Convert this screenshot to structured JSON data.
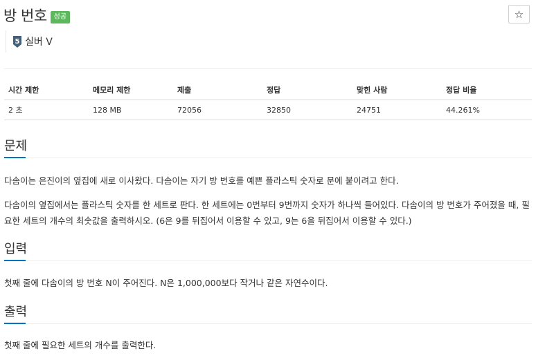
{
  "problem": {
    "title": "방 번호",
    "status": "성공",
    "star": "☆",
    "tier_number": "5",
    "tier_label": "실버 V"
  },
  "info_table": {
    "headers": [
      "시간 제한",
      "메모리 제한",
      "제출",
      "정답",
      "맞힌 사람",
      "정답 비율"
    ],
    "row": [
      "2 초",
      "128 MB",
      "72056",
      "32850",
      "24751",
      "44.261%"
    ]
  },
  "sections": {
    "description": {
      "title": "문제",
      "paragraphs": [
        "다솜이는 은진이의 옆집에 새로 이사왔다. 다솜이는 자기 방 번호를 예쁜 플라스틱 숫자로 문에 붙이려고 한다.",
        "다솜이의 옆집에서는 플라스틱 숫자를 한 세트로 판다. 한 세트에는 0번부터 9번까지 숫자가 하나씩 들어있다. 다솜이의 방 번호가 주어졌을 때, 필요한 세트의 개수의 최솟값을 출력하시오. (6은 9를 뒤집어서 이용할 수 있고, 9는 6을 뒤집어서 이용할 수 있다.)"
      ]
    },
    "input": {
      "title": "입력",
      "text": "첫째 줄에 다솜이의 방 번호 N이 주어진다. N은 1,000,000보다 작거나 같은 자연수이다."
    },
    "output": {
      "title": "출력",
      "text": "첫째 줄에 필요한 세트의 개수를 출력한다."
    }
  },
  "colors": {
    "status_green": "#5cb85c",
    "section_accent": "#0076c0",
    "tier_silver": "#435f7a"
  },
  "icons": {
    "tier": "silver-tier-shield-icon",
    "star": "star-outline-icon"
  }
}
